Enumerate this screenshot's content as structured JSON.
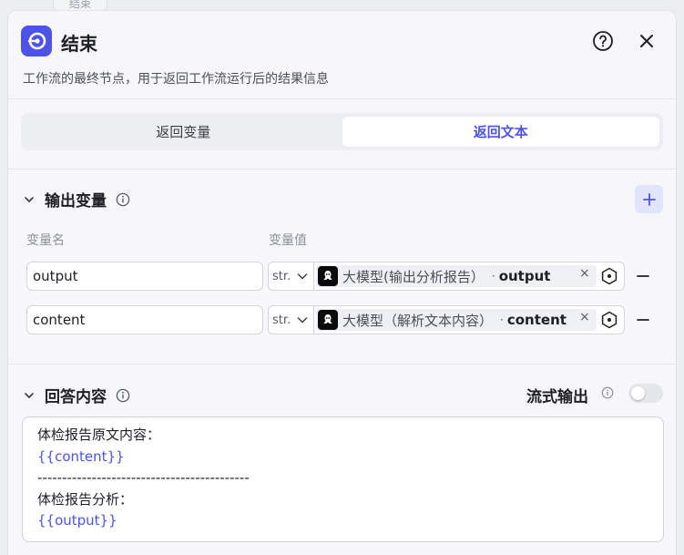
{
  "background_tab": "结束",
  "header": {
    "title": "结束",
    "description": "工作流的最终节点，用于返回工作流运行后的结果信息"
  },
  "mode_tabs": [
    {
      "label": "返回变量",
      "active": false
    },
    {
      "label": "返回文本",
      "active": true
    }
  ],
  "output_section": {
    "title": "输出变量",
    "columns": {
      "name": "变量名",
      "value": "变量值"
    },
    "rows": [
      {
        "name": "output",
        "type": "str.",
        "node": "大模型(输出分析报告）",
        "dot": "·",
        "variable": "output"
      },
      {
        "name": "content",
        "type": "str.",
        "node": "大模型（解析文本内容）",
        "dot": "·",
        "variable": "content"
      }
    ]
  },
  "answer_section": {
    "title": "回答内容",
    "stream_label": "流式输出",
    "stream_enabled": false,
    "lines": [
      {
        "text": "体检报告原文内容：",
        "kind": "text"
      },
      {
        "text": "{{content}}",
        "kind": "var"
      },
      {
        "text": "-------------------------------------------",
        "kind": "text"
      },
      {
        "text": "体检报告分析：",
        "kind": "text"
      },
      {
        "text": "{{output}}",
        "kind": "var"
      }
    ]
  },
  "colors": {
    "accent": "#4d53e8",
    "toggle_off": "#e4e6ea",
    "chip_bg": "#eef0f3"
  }
}
